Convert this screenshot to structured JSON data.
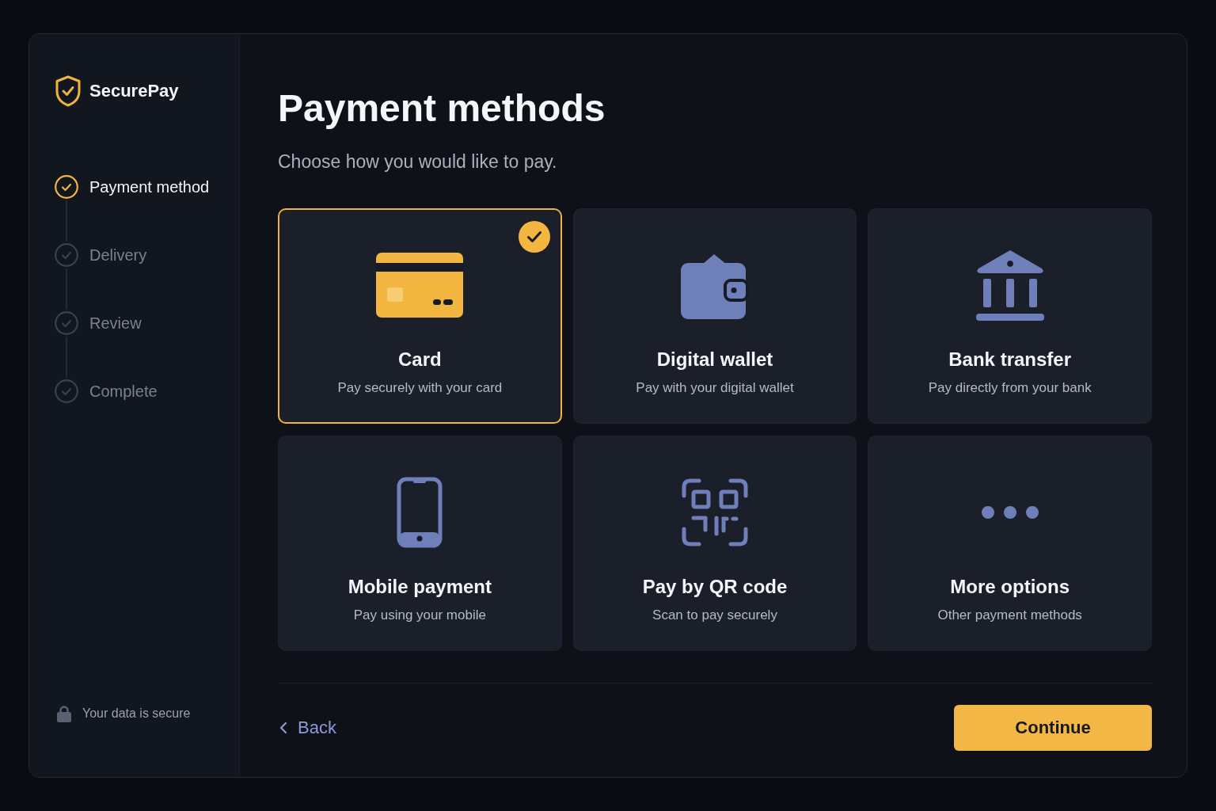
{
  "sidebar": {
    "brand": "SecurePay",
    "steps": [
      {
        "label": "Payment method",
        "selected": true
      },
      {
        "label": "Delivery",
        "selected": false
      },
      {
        "label": "Review",
        "selected": false
      },
      {
        "label": "Complete",
        "selected": false
      }
    ],
    "security_note": "Your data is secure"
  },
  "main": {
    "title": "Payment methods",
    "subtitle": "Choose how you would like to pay.",
    "methods": [
      {
        "kind": "card",
        "title": "Card",
        "description": "Pay securely with your card",
        "selected": true
      },
      {
        "kind": "wallet",
        "title": "Digital wallet",
        "description": "Pay with your digital wallet",
        "selected": false
      },
      {
        "kind": "bank",
        "title": "Bank transfer",
        "description": "Pay directly from your bank",
        "selected": false
      },
      {
        "kind": "mobile",
        "title": "Mobile payment",
        "description": "Pay using your mobile",
        "selected": false
      },
      {
        "kind": "qr",
        "title": "Pay by QR code",
        "description": "Scan to pay securely",
        "selected": false
      },
      {
        "kind": "more",
        "title": "More options",
        "description": "Other payment methods",
        "selected": false
      }
    ],
    "back": "Back",
    "continue": "Continue"
  }
}
